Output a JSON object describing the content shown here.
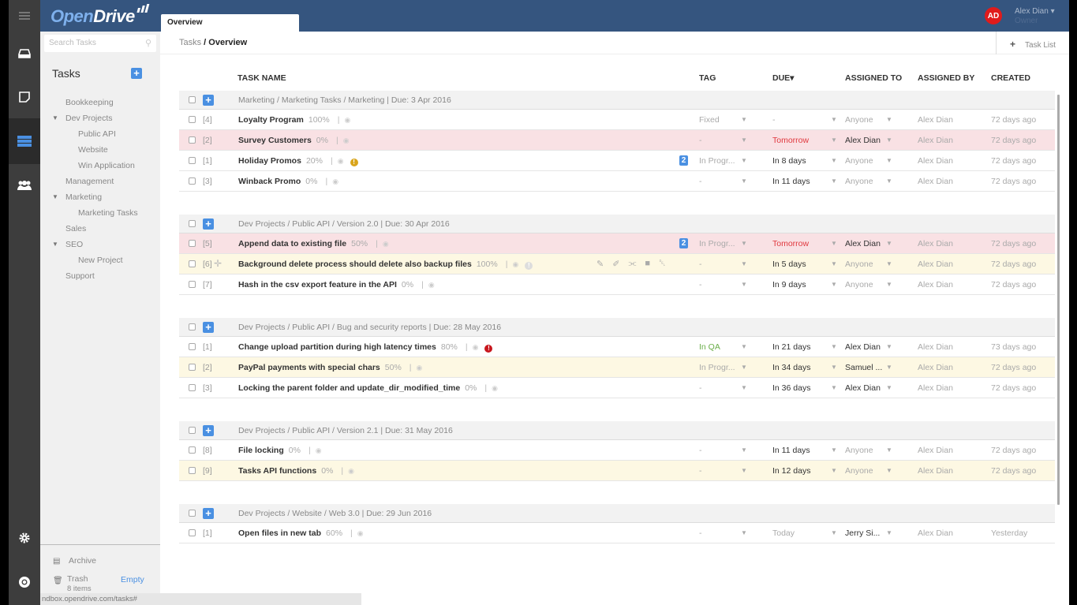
{
  "app": {
    "logo_part1": "Open",
    "logo_part2": "Drive",
    "active_tab": "Overview",
    "user_initials": "AD",
    "user_name": "Alex Dian ▾",
    "user_role": "Owner"
  },
  "leftbar": {
    "icons": [
      "menu-icon",
      "drive-icon",
      "notes-icon",
      "tasks-icon",
      "users-icon",
      "settings-icon",
      "help-icon"
    ]
  },
  "sidebar": {
    "search_placeholder": "Search Tasks",
    "title": "Tasks",
    "add_label": "+",
    "tree": [
      {
        "label": "Bookkeeping",
        "level": 1,
        "expanded": false
      },
      {
        "label": "Dev Projects",
        "level": 1,
        "expanded": true
      },
      {
        "label": "Public API",
        "level": 2
      },
      {
        "label": "Website",
        "level": 2
      },
      {
        "label": "Win Application",
        "level": 2
      },
      {
        "label": "Management",
        "level": 1,
        "expanded": false
      },
      {
        "label": "Marketing",
        "level": 1,
        "expanded": true
      },
      {
        "label": "Marketing Tasks",
        "level": 2
      },
      {
        "label": "Sales",
        "level": 1,
        "expanded": false
      },
      {
        "label": "SEO",
        "level": 1,
        "expanded": true
      },
      {
        "label": "New Project",
        "level": 2
      },
      {
        "label": "Support",
        "level": 1,
        "expanded": false
      }
    ],
    "archive_label": "Archive",
    "trash_label": "Trash",
    "trash_count": "8 items",
    "empty_label": "Empty"
  },
  "statusbar": {
    "url": "ndbox.opendrive.com/tasks#"
  },
  "header": {
    "breadcrumb_root": "Tasks",
    "breadcrumb_sep": " / ",
    "breadcrumb_current": "Overview",
    "task_list_plus": "+",
    "task_list_label": "Task List"
  },
  "columns": {
    "task_name": "TASK NAME",
    "tag": "TAG",
    "due": "DUE▾",
    "assigned_to": "ASSIGNED TO",
    "assigned_by": "ASSIGNED BY",
    "created": "CREATED"
  },
  "colors": {
    "accent": "#4a90e2",
    "topbar": "#35557f",
    "overdue_row": "#f9e1e4",
    "highlight_row": "#fdf8e3",
    "due_red": "#e0383e",
    "tag_green": "#6bae4a",
    "avatar": "#e01b1b"
  },
  "groups": [
    {
      "path": "Marketing /  Marketing Tasks  / Marketing | Due: 3 Apr 2016",
      "tasks": [
        {
          "num": "[4]",
          "name": "Loyalty Program",
          "progress": "100%",
          "row": "",
          "tag": "Fixed",
          "tag_style": "",
          "due": "-",
          "due_style": "grey",
          "assigned_to": "Anyone",
          "to_style": "",
          "assigned_by": "Alex Dian",
          "created": "72 days ago"
        },
        {
          "num": "[2]",
          "name": "Survey Customers",
          "progress": "0%",
          "row": "red",
          "tag": "-",
          "tag_style": "",
          "due": "Tomorrow",
          "due_style": "red",
          "assigned_to": "Alex Dian",
          "to_style": "dark",
          "assigned_by": "Alex Dian",
          "created": "72 days ago"
        },
        {
          "num": "[1]",
          "name": "Holiday Promos",
          "progress": "20%",
          "row": "",
          "warn": "yellow",
          "badge": "2",
          "tag": "In Progr...",
          "tag_style": "",
          "due": "In 8 days",
          "due_style": "",
          "assigned_to": "Anyone",
          "to_style": "",
          "assigned_by": "Alex Dian",
          "created": "72 days ago"
        },
        {
          "num": "[3]",
          "name": "Winback Promo",
          "progress": "0%",
          "row": "",
          "tag": "-",
          "tag_style": "",
          "due": "In 11 days",
          "due_style": "",
          "assigned_to": "Anyone",
          "to_style": "",
          "assigned_by": "Alex Dian",
          "created": "72 days ago"
        }
      ]
    },
    {
      "path": "Dev Projects /  Public API  / Version 2.0 | Due: 30 Apr 2016",
      "tasks": [
        {
          "num": "[5]",
          "name": "Append data to existing file",
          "progress": "50%",
          "row": "red",
          "badge": "2",
          "tag": "In Progr...",
          "tag_style": "",
          "due": "Tomorrow",
          "due_style": "red",
          "assigned_to": "Alex Dian",
          "to_style": "dark",
          "assigned_by": "Alex Dian",
          "created": "72 days ago"
        },
        {
          "num": "[6]",
          "name": "Background delete process should delete also backup files",
          "progress": "100%",
          "row": "yellow",
          "hover": true,
          "warn": "grey",
          "tag": "-",
          "tag_style": "",
          "due": "In 5 days",
          "due_style": "",
          "assigned_to": "Anyone",
          "to_style": "",
          "assigned_by": "Alex Dian",
          "created": "72 days ago"
        },
        {
          "num": "[7]",
          "name": "Hash in the csv export feature in the API",
          "progress": "0%",
          "row": "",
          "tag": "-",
          "tag_style": "",
          "due": "In 9 days",
          "due_style": "",
          "assigned_to": "Anyone",
          "to_style": "",
          "assigned_by": "Alex Dian",
          "created": "72 days ago"
        }
      ]
    },
    {
      "path": "Dev Projects /  Public API  / Bug and security reports | Due: 28 May 2016",
      "tasks": [
        {
          "num": "[1]",
          "name": "Change upload partition during high latency times",
          "progress": "80%",
          "row": "",
          "warn": "red",
          "tag": "In QA",
          "tag_style": "green",
          "due": "In 21 days",
          "due_style": "",
          "assigned_to": "Alex Dian",
          "to_style": "dark",
          "assigned_by": "Alex Dian",
          "created": "73 days ago"
        },
        {
          "num": "[2]",
          "name": "PayPal payments with special chars",
          "progress": "50%",
          "row": "yellow",
          "tag": "In Progr...",
          "tag_style": "",
          "due": "In 34 days",
          "due_style": "",
          "assigned_to": "Samuel ...",
          "to_style": "dark",
          "assigned_by": "Alex Dian",
          "created": "72 days ago"
        },
        {
          "num": "[3]",
          "name": "Locking the parent folder and update_dir_modified_time",
          "progress": "0%",
          "row": "",
          "tag": "-",
          "tag_style": "",
          "due": "In 36 days",
          "due_style": "",
          "assigned_to": "Alex Dian",
          "to_style": "dark",
          "assigned_by": "Alex Dian",
          "created": "72 days ago"
        }
      ]
    },
    {
      "path": "Dev Projects /  Public API  / Version 2.1 | Due: 31 May 2016",
      "tasks": [
        {
          "num": "[8]",
          "name": "File locking",
          "progress": "0%",
          "row": "",
          "tag": "-",
          "tag_style": "",
          "due": "In 11 days",
          "due_style": "",
          "assigned_to": "Anyone",
          "to_style": "",
          "assigned_by": "Alex Dian",
          "created": "72 days ago"
        },
        {
          "num": "[9]",
          "name": "Tasks API functions",
          "progress": "0%",
          "row": "yellow",
          "tag": "-",
          "tag_style": "",
          "due": "In 12 days",
          "due_style": "",
          "assigned_to": "Anyone",
          "to_style": "",
          "assigned_by": "Alex Dian",
          "created": "72 days ago"
        }
      ]
    },
    {
      "path": "Dev Projects /  Website  / Web 3.0 | Due: 29 Jun 2016",
      "tasks": [
        {
          "num": "[1]",
          "name": "Open files in new tab",
          "progress": "60%",
          "row": "",
          "tag": "-",
          "tag_style": "",
          "due": "Today",
          "due_style": "grey",
          "assigned_to": "Jerry Si...",
          "to_style": "dark",
          "assigned_by": "Alex Dian",
          "created": "Yesterday"
        }
      ]
    }
  ]
}
